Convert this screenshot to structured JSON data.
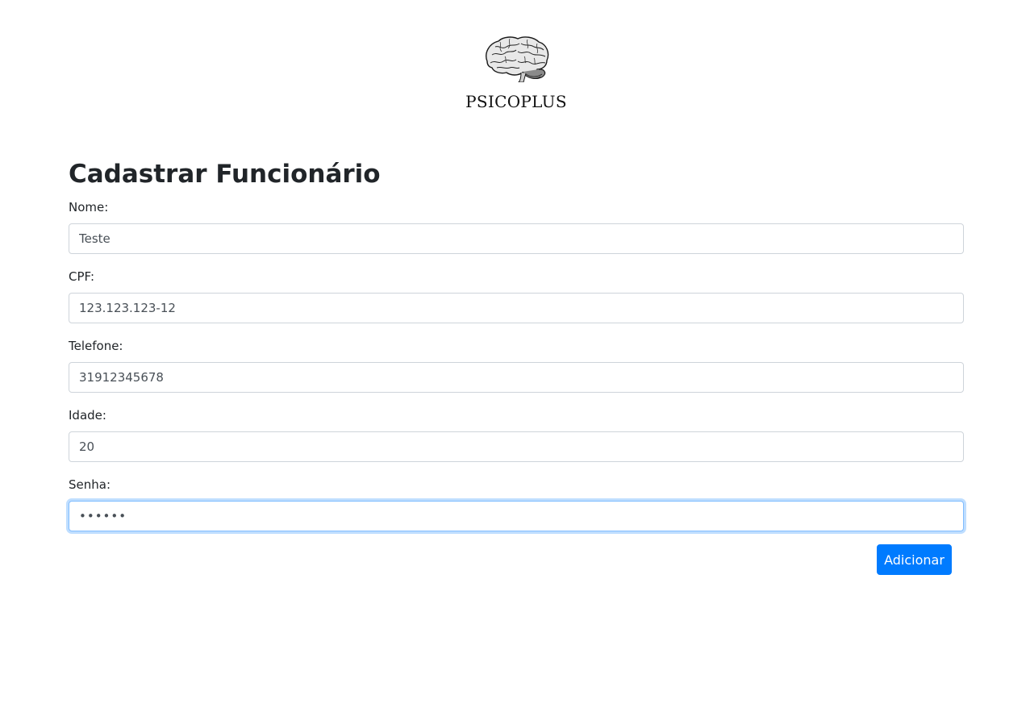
{
  "brand": {
    "name": "PSICOPLUS",
    "logo_icon": "brain-icon"
  },
  "form": {
    "title": "Cadastrar Funcionário",
    "fields": [
      {
        "label": "Nome:",
        "value": "Teste"
      },
      {
        "label": "CPF:",
        "value": "123.123.123-12"
      },
      {
        "label": "Telefone:",
        "value": "31912345678"
      },
      {
        "label": "Idade:",
        "value": "20"
      },
      {
        "label": "Senha:",
        "value": "••••••"
      }
    ],
    "submit_label": "Adicionar"
  },
  "colors": {
    "primary": "#007bff",
    "focus_border": "#80bdff",
    "input_border": "#ced4da",
    "text": "#212529"
  }
}
